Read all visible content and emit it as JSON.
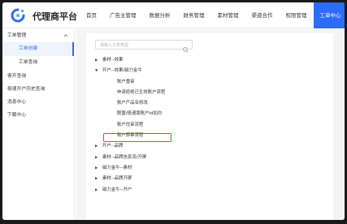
{
  "header": {
    "brand": "代理商平台",
    "nav": [
      {
        "label": "首页",
        "active": false
      },
      {
        "label": "广告主管理",
        "active": false
      },
      {
        "label": "数据分析",
        "active": false
      },
      {
        "label": "财务管理",
        "active": false
      },
      {
        "label": "素材管理",
        "active": false
      },
      {
        "label": "渠道合作",
        "active": false
      },
      {
        "label": "权限管理",
        "active": false
      },
      {
        "label": "工单中心",
        "active": true
      }
    ]
  },
  "sidebar": {
    "group": "工单管理",
    "sub_items": [
      {
        "label": "工单创建",
        "active": true
      },
      {
        "label": "工单查询",
        "active": false
      }
    ],
    "items": [
      "客开查询",
      "极速开户历史查询",
      "消息中心",
      "下载中心"
    ]
  },
  "main": {
    "search_placeholder": "请输入工单类型",
    "tree": [
      {
        "label": "素材--效果",
        "expanded": false,
        "level": 0
      },
      {
        "label": "开户--效果/磁力金牛",
        "expanded": true,
        "level": 0
      },
      {
        "label": "账户重审",
        "level": 1
      },
      {
        "label": "申请拒绝已生效账户流程",
        "level": 1
      },
      {
        "label": "账户产品名修改",
        "level": 1,
        "highlighted": true
      },
      {
        "label": "联盟/极速版账户id加白",
        "level": 1
      },
      {
        "label": "账户优审流程",
        "level": 1
      },
      {
        "label": "账户预审流程",
        "level": 1
      },
      {
        "label": "开户--品牌",
        "expanded": false,
        "level": 0
      },
      {
        "label": "素材--品牌信息流/开屏",
        "expanded": false,
        "level": 0
      },
      {
        "label": "磁力金牛--素材",
        "expanded": false,
        "level": 0
      },
      {
        "label": "素材--品牌开屏",
        "expanded": false,
        "level": 0
      },
      {
        "label": "磁力金牛--开户",
        "expanded": false,
        "level": 0
      }
    ]
  },
  "colors": {
    "accent": "#2d6cf6",
    "highlight": "#e0483c",
    "background": "#f3f4f6"
  },
  "icons": {
    "logo": "brand-logo-icon",
    "search": "search-icon",
    "collapse": "chevron-down-icon",
    "tree_collapsed": "caret-right-icon",
    "tree_expanded": "caret-down-icon"
  }
}
